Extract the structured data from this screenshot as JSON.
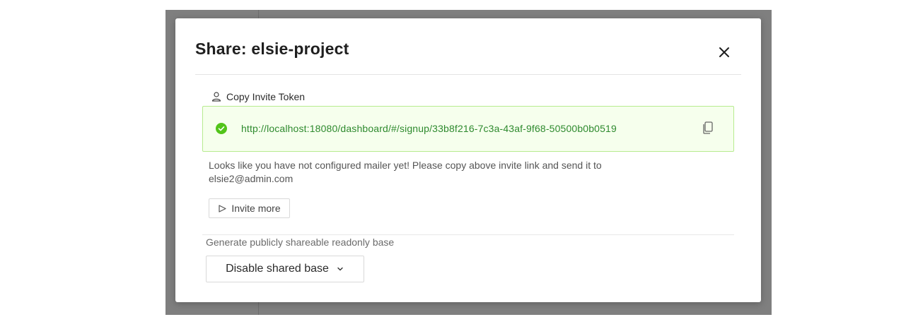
{
  "modal": {
    "title": "Share: elsie-project",
    "close_icon": "close-icon"
  },
  "invite": {
    "section_label": "Copy Invite Token",
    "section_icon": "user-icon",
    "token_url": "http://localhost:18080/dashboard/#/signup/33b8f216-7c3a-43af-9f68-50500b0b0519",
    "status_icon": "check-circle-icon",
    "copy_icon": "copy-icon",
    "notice": "Looks like you have not configured mailer yet! Please copy above invite link and send it to elsie2@admin.com",
    "invite_more_label": "Invite more",
    "invite_more_icon": "send-icon"
  },
  "shared_base": {
    "label": "Generate publicly shareable readonly base",
    "selected": "Disable shared base",
    "dropdown_icon": "chevron-down-icon"
  },
  "colors": {
    "success_bg": "#f6ffed",
    "success_border": "#b7eb8f",
    "success_text": "#2e8a2e",
    "success_icon": "#52c41a",
    "backdrop": "#7f7f7f"
  }
}
